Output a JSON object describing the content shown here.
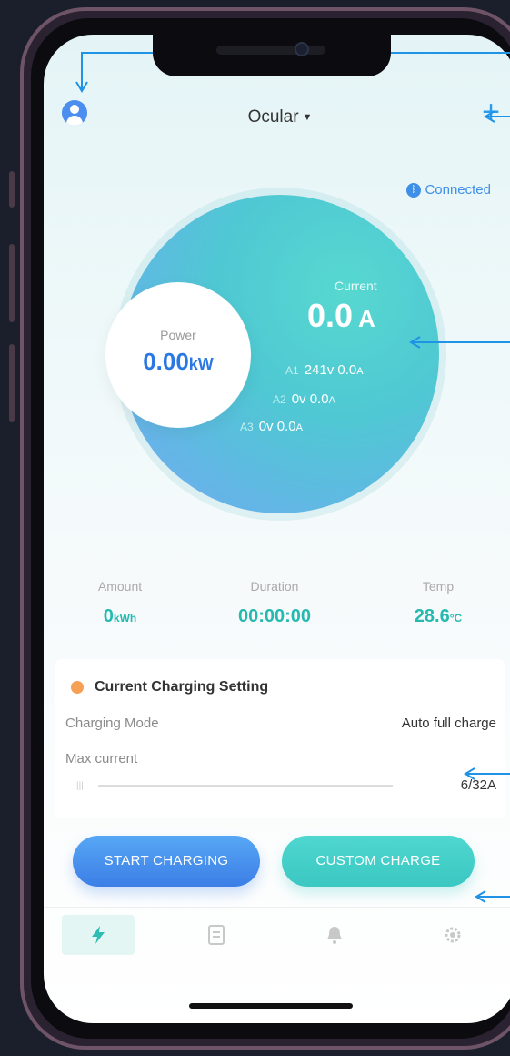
{
  "header": {
    "title": "Ocular"
  },
  "status": {
    "bluetooth_label": "Connected"
  },
  "power": {
    "label": "Power",
    "value": "0.00",
    "unit": "kW"
  },
  "current": {
    "label": "Current",
    "value": "0.0",
    "unit": "A",
    "phases": [
      {
        "tag": "A1",
        "voltage": "241v",
        "current": "0.0",
        "unit": "A"
      },
      {
        "tag": "A2",
        "voltage": "0v",
        "current": "0.0",
        "unit": "A"
      },
      {
        "tag": "A3",
        "voltage": "0v",
        "current": "0.0",
        "unit": "A"
      }
    ]
  },
  "stats": [
    {
      "label": "Amount",
      "value": "0",
      "unit": "kWh"
    },
    {
      "label": "Duration",
      "value": "00:00:00",
      "unit": ""
    },
    {
      "label": "Temp",
      "value": "28.6",
      "unit": "°C"
    }
  ],
  "settings": {
    "title": "Current Charging Setting",
    "mode_label": "Charging Mode",
    "mode_value": "Auto full charge",
    "max_current_label": "Max current",
    "max_current_value": "6/32A"
  },
  "buttons": {
    "start": "START CHARGING",
    "custom": "CUSTOM CHARGE"
  },
  "colors": {
    "accent_blue": "#3c7ee6",
    "accent_teal": "#3bc7c2",
    "annotation": "#1f93e6"
  }
}
